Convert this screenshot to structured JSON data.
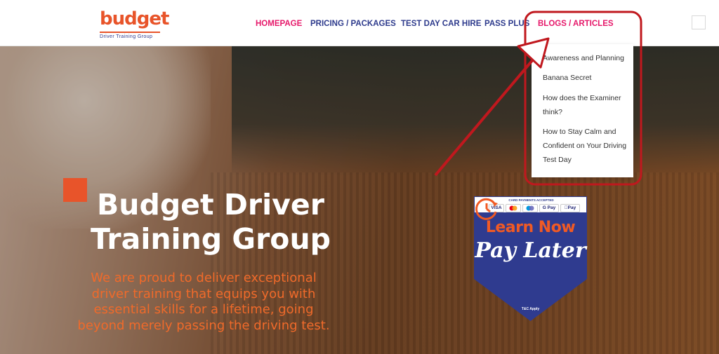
{
  "brand": {
    "name": "budget",
    "tagline": "Driver Training Group",
    "accent_color": "#e8542a",
    "nav_color": "#2d3a8c",
    "active_color": "#e6186a"
  },
  "nav": {
    "items": [
      {
        "label": "HOMEPAGE"
      },
      {
        "label": "PRICING / PACKAGES"
      },
      {
        "label": "TEST DAY CAR HIRE"
      },
      {
        "label": "PASS PLUS"
      },
      {
        "label": "BLOGS / ARTICLES"
      }
    ]
  },
  "dropdown": {
    "items": [
      {
        "label": "Awareness and Planning"
      },
      {
        "label": "Banana Secret"
      },
      {
        "label": "How does the Examiner think?"
      },
      {
        "label": "How to Stay Calm and Confident on Your Driving Test Day"
      }
    ]
  },
  "hero": {
    "title": "Budget Driver Training Group",
    "text": "We are proud to deliver exceptional driver training that equips you with essential skills for a lifetime, going beyond merely passing the driving test."
  },
  "badge": {
    "cards_label": "CARD PAYMENTS ACCEPTED",
    "payment_methods": [
      "VISA",
      "Mastercard",
      "Maestro",
      "G Pay",
      "Apple Pay"
    ],
    "payment_labels": {
      "visa": "VISA",
      "gpay": "G Pay",
      "applepay": "Pay"
    },
    "learn": "Learn Now",
    "pay": "Pay Later",
    "terms": "T&C Apply",
    "icon": "clock-arrow-icon"
  },
  "annotation": {
    "color": "#c0181e"
  }
}
